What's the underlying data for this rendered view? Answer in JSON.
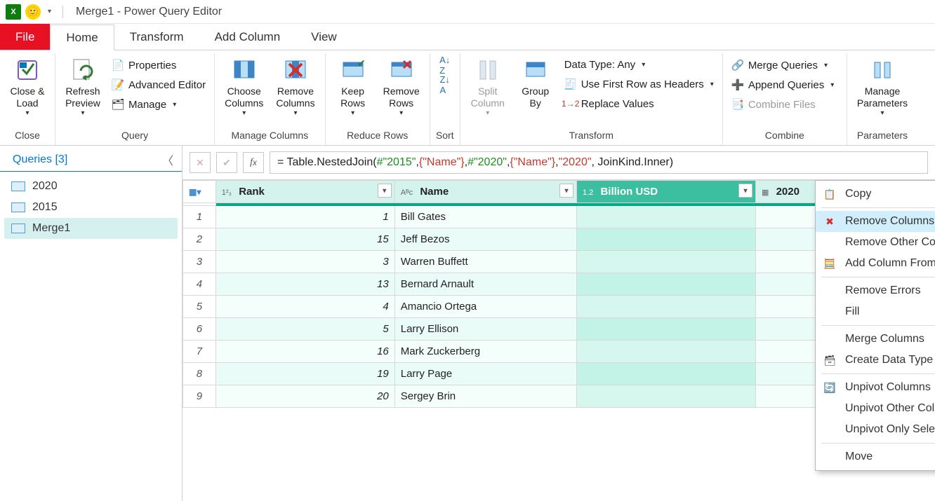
{
  "window_title": "Merge1 - Power Query Editor",
  "tabs": {
    "file": "File",
    "home": "Home",
    "transform": "Transform",
    "add_column": "Add Column",
    "view": "View"
  },
  "ribbon": {
    "close_load": "Close &\nLoad",
    "close_group": "Close",
    "refresh_preview": "Refresh\nPreview",
    "properties": "Properties",
    "advanced_editor": "Advanced Editor",
    "manage": "Manage",
    "query_group": "Query",
    "choose_columns": "Choose\nColumns",
    "remove_columns": "Remove\nColumns",
    "manage_columns_group": "Manage Columns",
    "keep_rows": "Keep\nRows",
    "remove_rows": "Remove\nRows",
    "reduce_rows_group": "Reduce Rows",
    "sort_group": "Sort",
    "split_column": "Split\nColumn",
    "group_by": "Group\nBy",
    "data_type": "Data Type: Any",
    "first_row_headers": "Use First Row as Headers",
    "replace_values": "Replace Values",
    "transform_group": "Transform",
    "merge_queries": "Merge Queries",
    "append_queries": "Append Queries",
    "combine_files": "Combine Files",
    "combine_group": "Combine",
    "manage_parameters": "Manage\nParameters",
    "parameters_group": "Parameters"
  },
  "queries": {
    "header": "Queries [3]",
    "items": [
      "2020",
      "2015",
      "Merge1"
    ],
    "selected": "Merge1"
  },
  "formula": {
    "prefix": "= Table.NestedJoin(",
    "p1": "#\"2015\"",
    "p2": "{\"Name\"}",
    "p3": "#\"2020\"",
    "p4": "{\"Name\"}",
    "p5": "\"2020\"",
    "suffix": ", JoinKind.Inner)"
  },
  "columns": {
    "rank": "Rank",
    "name": "Name",
    "billion": "Billion USD",
    "y2020": "2020"
  },
  "rows": [
    {
      "rank": 1,
      "name": "Bill Gates"
    },
    {
      "rank": 15,
      "name": "Jeff Bezos"
    },
    {
      "rank": 3,
      "name": "Warren Buffett"
    },
    {
      "rank": 13,
      "name": "Bernard Arnault"
    },
    {
      "rank": 4,
      "name": "Amancio Ortega"
    },
    {
      "rank": 5,
      "name": "Larry Ellison"
    },
    {
      "rank": 16,
      "name": "Mark Zuckerberg"
    },
    {
      "rank": 19,
      "name": "Larry Page"
    },
    {
      "rank": 20,
      "name": "Sergey Brin"
    }
  ],
  "context_menu": {
    "copy": "Copy",
    "remove_columns": "Remove Columns",
    "remove_other_columns": "Remove Other Columns",
    "add_column_examples": "Add Column From Examples...",
    "remove_errors": "Remove Errors",
    "fill": "Fill",
    "merge_columns": "Merge Columns",
    "create_data_type": "Create Data Type",
    "unpivot_columns": "Unpivot Columns",
    "unpivot_other_columns": "Unpivot Other Columns",
    "unpivot_only_selected": "Unpivot Only Selected Columns",
    "move": "Move"
  }
}
